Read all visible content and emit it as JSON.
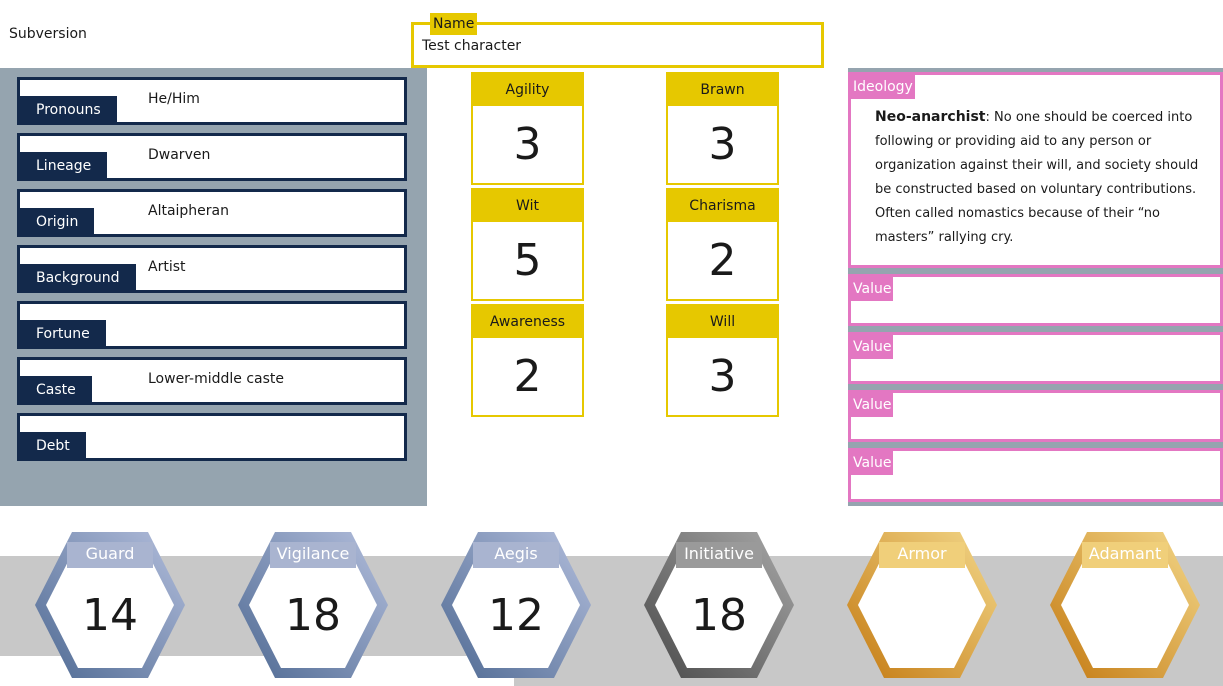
{
  "app": {
    "title": "Subversion"
  },
  "name_field": {
    "label": "Name",
    "value": "Test character"
  },
  "info": [
    {
      "label": "Pronouns",
      "value": "He/Him"
    },
    {
      "label": "Lineage",
      "value": "Dwarven"
    },
    {
      "label": "Origin",
      "value": "Altaipheran"
    },
    {
      "label": "Background",
      "value": "Artist"
    },
    {
      "label": "Fortune",
      "value": ""
    },
    {
      "label": "Caste",
      "value": "Lower-middle caste"
    },
    {
      "label": "Debt",
      "value": ""
    }
  ],
  "attributes": [
    {
      "name": "Agility",
      "value": "3"
    },
    {
      "name": "Brawn",
      "value": "3"
    },
    {
      "name": "Wit",
      "value": "5"
    },
    {
      "name": "Charisma",
      "value": "2"
    },
    {
      "name": "Awareness",
      "value": "2"
    },
    {
      "name": "Will",
      "value": "3"
    }
  ],
  "ideology": {
    "label": "Ideology",
    "name": "Neo-anarchist",
    "description": ": No one should be coerced into following or providing aid to any person or organization against their will, and society should be constructed based on voluntary contributions. Often called nomastics because of their “no masters” rallying cry."
  },
  "values": [
    {
      "label": "Value",
      "value": ""
    },
    {
      "label": "Value",
      "value": ""
    },
    {
      "label": "Value",
      "value": ""
    },
    {
      "label": "Value",
      "value": ""
    }
  ],
  "defenses": [
    {
      "label": "Guard",
      "value": "14"
    },
    {
      "label": "Vigilance",
      "value": "18"
    },
    {
      "label": "Aegis",
      "value": "12"
    },
    {
      "label": "Initiative",
      "value": "18"
    },
    {
      "label": "Armor",
      "value": ""
    },
    {
      "label": "Adamant",
      "value": ""
    }
  ],
  "colors": {
    "accent_yellow": "#e6c800",
    "navy": "#13294b",
    "panel_gray": "#95a4af",
    "pink": "#e377c2",
    "hex_blue_dark": "#5a7297",
    "hex_blue_light": "#a9b4d0",
    "hex_gray_dark": "#555555",
    "hex_gray_light": "#9a9a9a",
    "hex_gold_dark": "#c8841c",
    "hex_gold_light": "#f0cf7a"
  }
}
